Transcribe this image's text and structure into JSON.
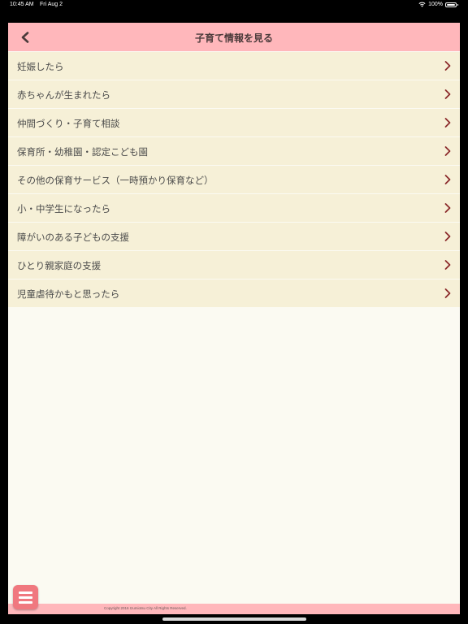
{
  "status_bar": {
    "time": "10:45 AM",
    "date": "Fri Aug 2",
    "battery": "100%"
  },
  "header": {
    "title": "子育て情報を見る",
    "back_icon": "chevron-left-icon"
  },
  "menu": {
    "items": [
      {
        "label": "妊娠したら"
      },
      {
        "label": "赤ちゃんが生まれたら"
      },
      {
        "label": "仲間づくり・子育て相談"
      },
      {
        "label": "保育所・幼稚園・認定こども園"
      },
      {
        "label": "その他の保育サービス（一時預かり保育など）"
      },
      {
        "label": "小・中学生になったら"
      },
      {
        "label": "障がいのある子どもの支援"
      },
      {
        "label": "ひとり親家庭の支援"
      },
      {
        "label": "児童虐待かもと思ったら"
      }
    ],
    "chevron_icon": "chevron-right-icon"
  },
  "footer": {
    "copyright": "Copyright 2016 Izumiotsu City All Rights Reserved."
  },
  "fab": {
    "icon": "hamburger-menu-icon"
  },
  "colors": {
    "navbar": "#ffb7bb",
    "item_bg": "#f6f0d7",
    "page_bg": "#fbfaf2",
    "chevron": "#8b2b2b",
    "fab": "#f0787f"
  }
}
